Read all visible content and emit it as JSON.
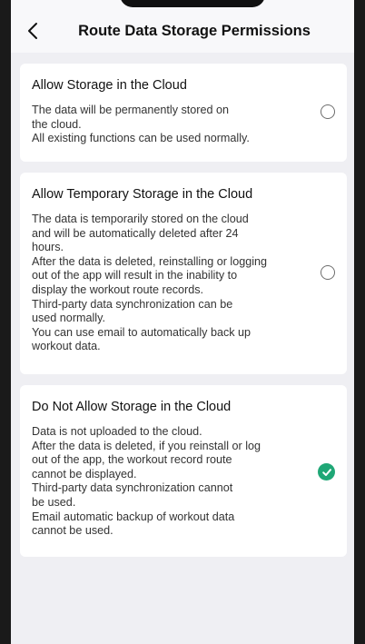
{
  "header": {
    "title": "Route Data Storage Permissions"
  },
  "options": [
    {
      "title": "Allow Storage in the Cloud",
      "lines": [
        "The data will be permanently stored on",
        "the cloud.",
        "All existing functions can be used normally."
      ],
      "selected": false
    },
    {
      "title": "Allow Temporary Storage in the Cloud",
      "lines": [
        "The data is temporarily stored on the cloud",
        "and will be automatically deleted after 24",
        "hours.",
        "After the data is deleted, reinstalling or logging",
        "out of the app will result in the inability to",
        "display the workout route records.",
        "Third-party data synchronization can be",
        "used normally.",
        "You can use email to automatically back up",
        "workout data."
      ],
      "selected": false
    },
    {
      "title": "Do Not Allow Storage in the Cloud",
      "lines": [
        "Data is not uploaded to the cloud.",
        "After the data is deleted, if you reinstall or log",
        "out of the app, the workout record route",
        "cannot be displayed.",
        "Third-party data synchronization cannot",
        "be used.",
        "Email automatic backup of workout data",
        "cannot be used."
      ],
      "selected": true
    }
  ],
  "colors": {
    "accent": "#1fa776",
    "background": "#efeff3",
    "card": "#ffffff"
  },
  "icons": {
    "back": "chevron-left-icon",
    "radio_checked": "check-icon"
  }
}
